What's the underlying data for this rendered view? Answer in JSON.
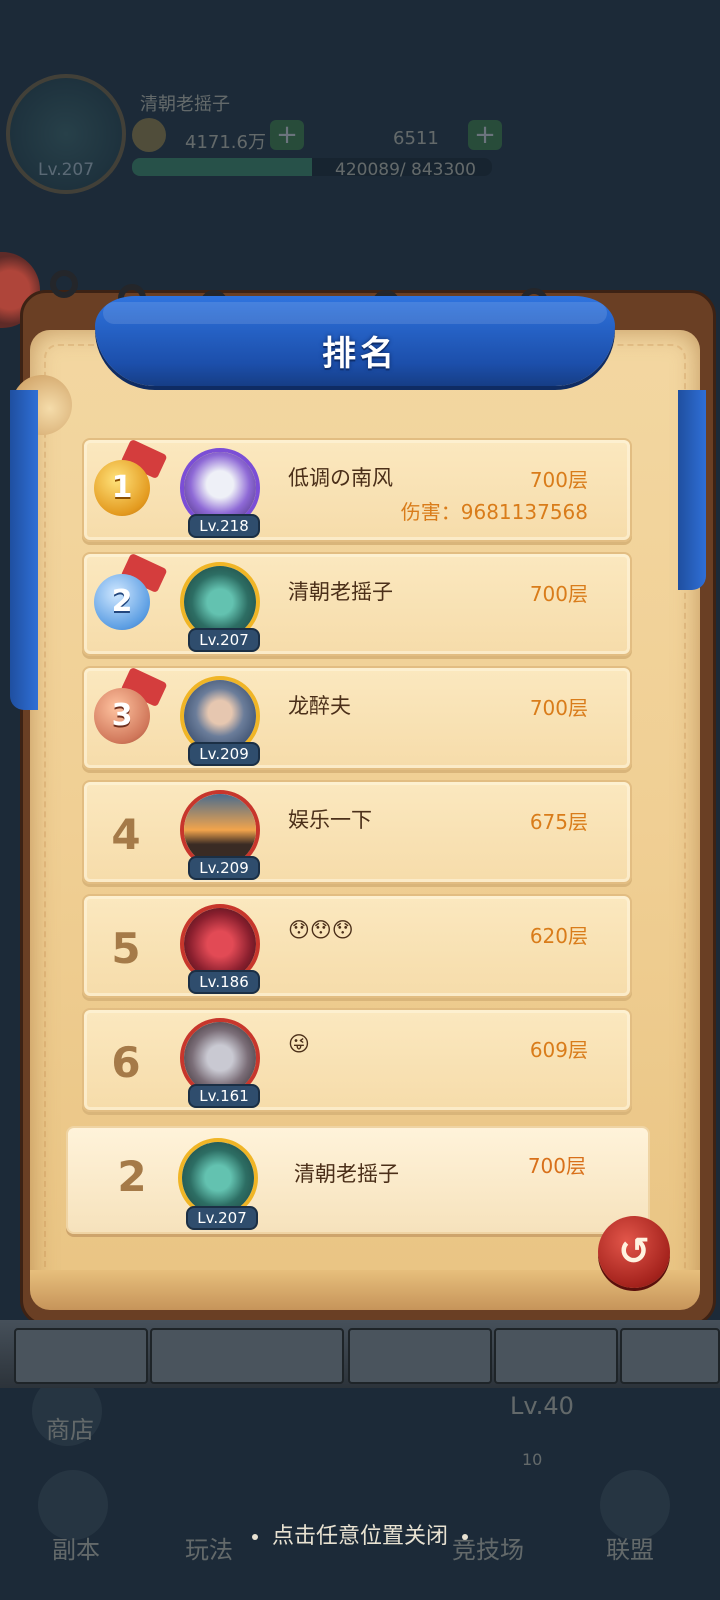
{
  "background": {
    "player_name": "清朝老摇子",
    "level": "Lv.207",
    "coins": "4171.6万",
    "gems": "6511",
    "exp_text": "420089/ 843300",
    "exp_fraction": 0.5,
    "bottom_buttons": [
      "商店",
      "Lv.40",
      "副本",
      "玩法",
      "竞技场",
      "联盟"
    ],
    "bottom_badge": "10"
  },
  "panel": {
    "title": "排名",
    "rows": [
      {
        "rank": "1",
        "level": "Lv.218",
        "name": "低调の南风",
        "floor": "700层",
        "damage": "伤害：9681137568"
      },
      {
        "rank": "2",
        "level": "Lv.207",
        "name": "清朝老摇子",
        "floor": "700层"
      },
      {
        "rank": "3",
        "level": "Lv.209",
        "name": "龙醉夫",
        "floor": "700层"
      },
      {
        "rank": "4",
        "level": "Lv.209",
        "name": "娱乐一下",
        "floor": "675层"
      },
      {
        "rank": "5",
        "level": "Lv.186",
        "name": "😯😯😯",
        "floor": "620层"
      },
      {
        "rank": "6",
        "level": "Lv.161",
        "name": "😜",
        "floor": "609层"
      }
    ],
    "self_row": {
      "rank": "2",
      "level": "Lv.207",
      "name": "清朝老摇子",
      "floor": "700层"
    }
  },
  "close_hint": "点击任意位置关闭",
  "icons": {
    "close_seal": "return-seal-icon",
    "medal_1": "gold-medal-icon",
    "medal_2": "silver-medal-icon",
    "medal_3": "bronze-medal-icon"
  },
  "colors": {
    "banner": "#1c4fab",
    "floor_text": "#d97c1a",
    "name_text": "#4b2f19",
    "seal": "#a5231d"
  }
}
